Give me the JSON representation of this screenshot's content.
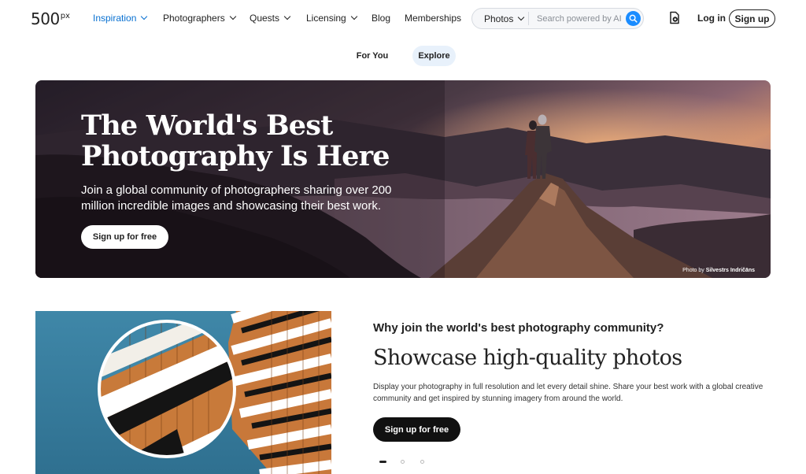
{
  "logo": {
    "main": "500",
    "sup": "px"
  },
  "nav": {
    "items": [
      {
        "label": "Inspiration",
        "dropdown": true,
        "active": true
      },
      {
        "label": "Photographers",
        "dropdown": true
      },
      {
        "label": "Quests",
        "dropdown": true
      },
      {
        "label": "Licensing",
        "dropdown": true
      },
      {
        "label": "Blog",
        "dropdown": false
      },
      {
        "label": "Memberships",
        "dropdown": false
      }
    ],
    "search": {
      "type": "Photos",
      "placeholder": "Search powered by AI",
      "value": ""
    },
    "upload_icon": "upload-photo-icon",
    "login": "Log in",
    "signup": "Sign up"
  },
  "tabs": [
    {
      "label": "For You",
      "active": false
    },
    {
      "label": "Explore",
      "active": true
    }
  ],
  "hero": {
    "title_line1": "The World's Best",
    "title_line2": "Photography Is Here",
    "subtitle": "Join a global community of photographers sharing over 200 million incredible images and showcasing their best work.",
    "cta": "Sign up for free",
    "credit_prefix": "Photo by",
    "credit_name": "Silvestrs Indričāns"
  },
  "feature": {
    "eyebrow": "Why join the world's best photography community?",
    "title": "Showcase high-quality photos",
    "description": "Display your photography in full resolution and let every detail shine. Share your best work with a global creative community and get inspired by stunning imagery from around the world.",
    "cta": "Sign up for free",
    "slides_total": 3,
    "slide_active": 1
  },
  "colors": {
    "accent": "#0870d1",
    "search_button": "#1a8cff",
    "tab_active_bg": "#e8f1fb",
    "dark_button": "#111111"
  }
}
